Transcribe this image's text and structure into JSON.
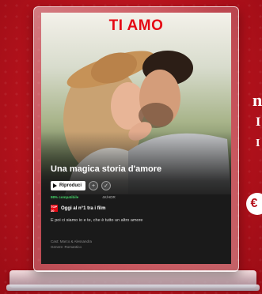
{
  "background": {
    "color": "#b5121c"
  },
  "side": {
    "letter_1": "n",
    "letter_2": "I",
    "letter_3": "I",
    "badge": "€"
  },
  "card": {
    "brand": "TI AMO",
    "brand_color": "#e50914",
    "title": "Una magica storia d'amore",
    "play_label": "Riproduci",
    "add_icon": "plus-icon",
    "like_icon": "thumbs-up-icon",
    "match": "98% compatibile",
    "quality": "4K/HDR",
    "rank_badge": "TOP 10",
    "rank": "Oggi al n°1 tra i film",
    "description": "E poi ci siamo io e te, che è tutto un altro amore",
    "cast": "Cast: Marco & Alessandra",
    "genre": "Genere: Romantico"
  }
}
